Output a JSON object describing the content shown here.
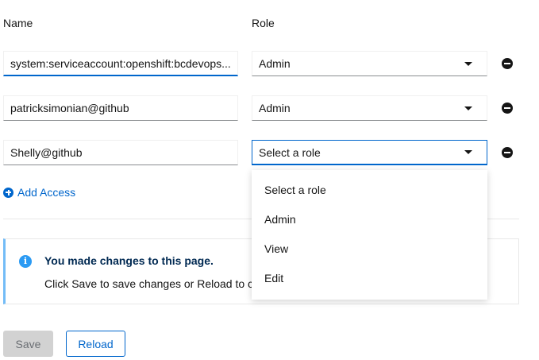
{
  "headers": {
    "name": "Name",
    "role": "Role"
  },
  "rows": [
    {
      "name": "system:serviceaccount:openshift:bcdevops...",
      "role": "Admin"
    },
    {
      "name": "patricksimonian@github",
      "role": "Admin"
    },
    {
      "name": "Shelly@github",
      "role": "Select a role"
    }
  ],
  "add_access_label": "Add Access",
  "alert": {
    "title": "You made changes to this page.",
    "body": "Click Save to save changes or Reload to ca"
  },
  "dropdown": {
    "options": [
      "Select a role",
      "Admin",
      "View",
      "Edit"
    ]
  },
  "buttons": {
    "save": "Save",
    "reload": "Reload"
  }
}
